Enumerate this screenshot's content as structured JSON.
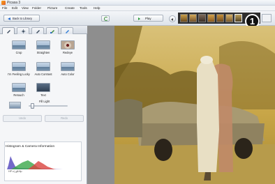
{
  "window": {
    "title": "Picasa 3"
  },
  "menu": [
    "File",
    "Edit",
    "View",
    "Folder",
    "Picture",
    "Create",
    "Tools",
    "Help"
  ],
  "toolbar": {
    "back_label": "Back to Library",
    "play_label": "Play"
  },
  "callout": {
    "number": "1"
  },
  "tools": [
    {
      "label": "Crop"
    },
    {
      "label": "Straighten"
    },
    {
      "label": "Redeye"
    },
    {
      "label": "I'm Feeling Lucky"
    },
    {
      "label": "Auto Contrast"
    },
    {
      "label": "Auto Color"
    },
    {
      "label": "Retouch"
    },
    {
      "label": "Text"
    }
  ],
  "fill_light": {
    "label": "Fill Light",
    "value": 0.06
  },
  "buttons": {
    "undo": "Undo",
    "redo": "Redo"
  },
  "histogram": {
    "title": "Histogram & Camera Information",
    "caption": "HP ci_g8.ftp"
  },
  "colors": {
    "photo_tint": "#b9922a",
    "panel_bg": "#f5f6f8",
    "viewer_bg": "#8e8e8e",
    "badge": "#111111"
  }
}
